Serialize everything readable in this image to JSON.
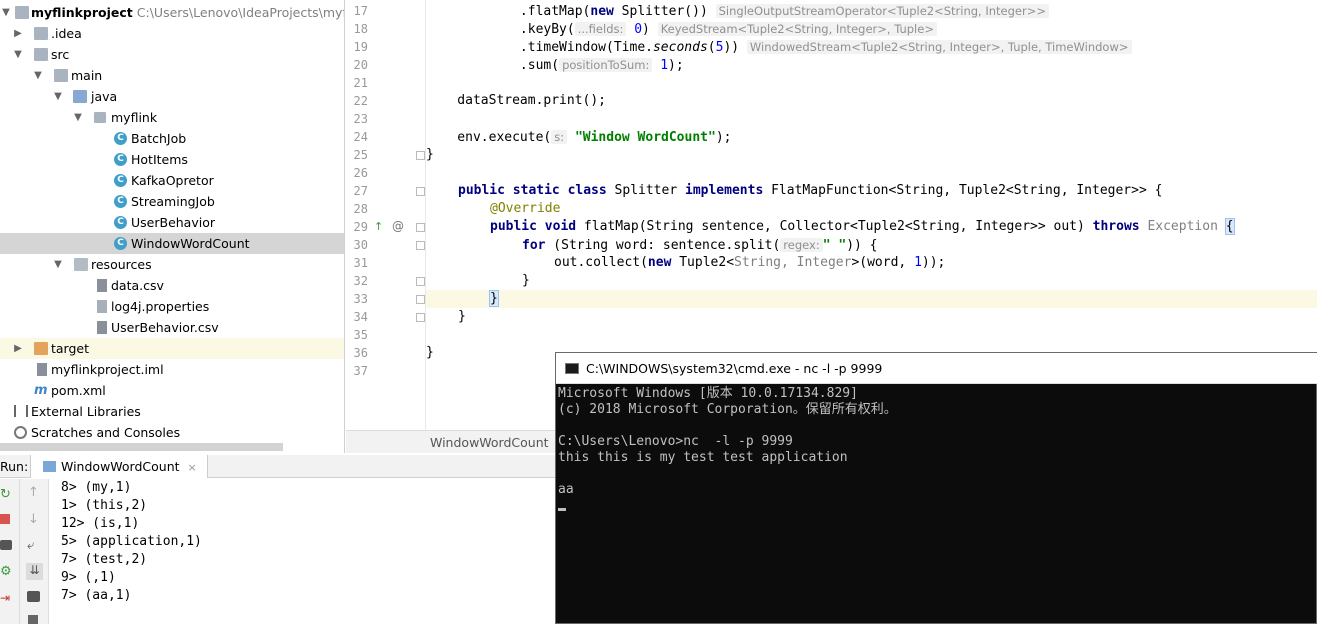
{
  "project_tree": {
    "root": {
      "name": "myflinkproject",
      "path": "C:\\Users\\Lenovo\\IdeaProjects\\myflink"
    },
    "items": [
      {
        "label": ".idea"
      },
      {
        "label": "src"
      },
      {
        "label": "main"
      },
      {
        "label": "java"
      },
      {
        "label": "myflink"
      },
      {
        "label": "BatchJob"
      },
      {
        "label": "HotItems"
      },
      {
        "label": "KafkaOpretor"
      },
      {
        "label": "StreamingJob"
      },
      {
        "label": "UserBehavior"
      },
      {
        "label": "WindowWordCount"
      },
      {
        "label": "resources"
      },
      {
        "label": "data.csv"
      },
      {
        "label": "log4j.properties"
      },
      {
        "label": "UserBehavior.csv"
      },
      {
        "label": "target"
      },
      {
        "label": "myflinkproject.iml"
      },
      {
        "label": "pom.xml"
      },
      {
        "label": "External Libraries"
      },
      {
        "label": "Scratches and Consoles"
      }
    ],
    "class_icon_letter": "C"
  },
  "editor": {
    "line_numbers": [
      "17",
      "18",
      "19",
      "20",
      "21",
      "22",
      "23",
      "24",
      "25",
      "26",
      "27",
      "28",
      "29",
      "30",
      "31",
      "32",
      "33",
      "34",
      "35",
      "36",
      "37"
    ],
    "lines": {
      "l17_a": "            .flatMap(",
      "l17_kw": "new",
      "l17_b": " Splitter())",
      "l17_hint": "SingleOutputStreamOperator<Tuple2<String, Integer>>",
      "l18_a": "            .keyBy(",
      "l18_hint1": "...fields:",
      "l18_num": "0",
      "l18_b": ")",
      "l18_hint2": "KeyedStream<Tuple2<String, Integer>, Tuple>",
      "l19_a": "            .timeWindow(Time.",
      "l19_it": "seconds",
      "l19_b": "(",
      "l19_num": "5",
      "l19_c": "))",
      "l19_hint": "WindowedStream<Tuple2<String, Integer>, Tuple, TimeWindow>",
      "l20_a": "            .sum(",
      "l20_hint": "positionToSum:",
      "l20_num": "1",
      "l20_b": ");",
      "l22": "    dataStream.print();",
      "l24_a": "    env.execute(",
      "l24_hint": "s:",
      "l24_str": "\"Window WordCount\"",
      "l24_b": ");",
      "l25": "}",
      "l27_kw1": "public static class",
      "l27_a": " Splitter ",
      "l27_kw2": "implements",
      "l27_b": " FlatMapFunction<String, Tuple2<String, Integer>> {",
      "l28_ann": "@Override",
      "l29_kw1": "public void",
      "l29_a": " flatMap(String sentence, Collector<Tuple2<String, Integer>> out) ",
      "l29_kw2": "throws",
      "l29_gray": "Exception",
      "l29_brace": "{",
      "l30_kw": "for",
      "l30_a": " (String word: sentence.split(",
      "l30_hint": "regex:",
      "l30_str": "\" \"",
      "l30_b": ")) {",
      "l31_a": "out.collect(",
      "l31_kw": "new",
      "l31_b": " Tuple2<",
      "l31_gray": "String, Integer",
      "l31_c": ">(word, ",
      "l31_num": "1",
      "l31_d": "));",
      "l32": "}",
      "l33": "}",
      "l34": "}",
      "l36": "}"
    },
    "gutter_marks": {
      "override_up": "↑",
      "override_at": "@"
    },
    "tab": "WindowWordCount"
  },
  "run_panel": {
    "label": "Run:",
    "tab": "WindowWordCount",
    "tab_close": "×",
    "output": [
      "8> (my,1)",
      "1> (this,2)",
      "12> (is,1)",
      "5> (application,1)",
      "7> (test,2)",
      "9> (,1)",
      "7> (aa,1)"
    ]
  },
  "cmd": {
    "title": "C:\\WINDOWS\\system32\\cmd.exe - nc  -l -p 9999",
    "lines": [
      "Microsoft Windows [版本 10.0.17134.829]",
      "(c) 2018 Microsoft Corporation。保留所有权利。",
      "",
      "C:\\Users\\Lenovo>nc  -l -p 9999",
      "this this is my test test application",
      "",
      "aa"
    ]
  }
}
